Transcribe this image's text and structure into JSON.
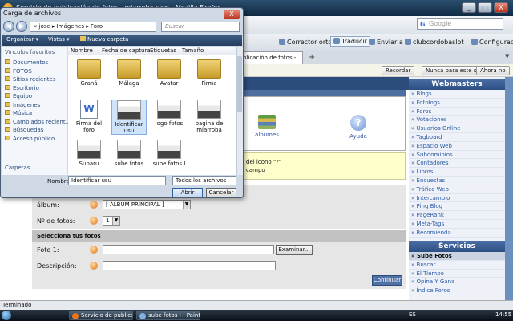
{
  "firefox": {
    "title": "Servicio de publicación de fotos - miarroba.com - Mozilla Firefox",
    "search_placeholder": "Google",
    "search_icon_letter": "G",
    "toolbar": {
      "spelling": "Corrector ortográfico",
      "translate": "Traducir",
      "send": "Enviar a",
      "bookmark": "clubcordobaslot",
      "config": "Configuración"
    },
    "tab_label": "blicación de fotos -",
    "notify": {
      "remember": "Recordar",
      "never": "Nunca para este sitio",
      "not_now": "Ahora no"
    },
    "status": "Terminado"
  },
  "window_buttons": {
    "minimize": "_",
    "maximize": "□",
    "close": "X"
  },
  "dialog": {
    "title": "Carga de archivos",
    "close": "X",
    "nav_back": "◀",
    "nav_forward": "▶",
    "address": "« jose ▸ Imágenes ▸ Foro",
    "search_placeholder": "Buscar",
    "toolbar": {
      "organize": "Organizar ▾",
      "views": "Vistas ▾",
      "new_folder": "Nueva carpeta"
    },
    "favorites_heading": "Vínculos favoritos",
    "favorites": [
      "Documentos",
      "FOTOS",
      "Sitios recientes",
      "Escritorio",
      "Equipo",
      "Imágenes",
      "Música",
      "Cambiados recient...",
      "Búsquedas",
      "Acceso público"
    ],
    "folders_label": "Carpetas",
    "columns": [
      "Nombre",
      "Fecha de captura",
      "Etiquetas",
      "Tamaño"
    ],
    "files": [
      {
        "name": "Graná",
        "type": "folder"
      },
      {
        "name": "Málaga",
        "type": "folder"
      },
      {
        "name": "Avatar",
        "type": "folder"
      },
      {
        "name": "Firma",
        "type": "folder"
      },
      {
        "name": "Firma del foro",
        "type": "doc"
      },
      {
        "name": "Identificar usu",
        "type": "image",
        "selected": true
      },
      {
        "name": "logo fotos",
        "type": "image"
      },
      {
        "name": "pagina de miarroba",
        "type": "image"
      },
      {
        "name": "Subaru",
        "type": "image"
      },
      {
        "name": "sube fotos",
        "type": "image"
      },
      {
        "name": "sube fotos I",
        "type": "image"
      }
    ],
    "filename_label": "Nombre:",
    "filename_value": "Identificar usu",
    "filter": "Todos los archivos",
    "open": "Abrir",
    "cancel": "Cancelar"
  },
  "page": {
    "icons": [
      {
        "label": "álbumes"
      },
      {
        "label": "Ayuda"
      }
    ],
    "notice_line1": "del icono \"?\"",
    "notice_line2": "campo",
    "form": {
      "album_label": "álbum:",
      "album_value": "[ ÁLBUM PRINCIPAL ]",
      "count_label": "Nº de fotos:",
      "count_value": "1",
      "section_title": "Selecciona tus fotos",
      "photo_label": "Foto 1:",
      "browse": "Examinar...",
      "desc_label": "Descripción:",
      "continue": "Continuar"
    }
  },
  "sidebar": {
    "webmasters_title": "Webmasters",
    "webmasters": [
      "Blogs",
      "Fotologs",
      "Foros",
      "Votaciones",
      "Usuarios Online",
      "Tagboard",
      "Espacio Web",
      "Subdominios",
      "Contadores",
      "Libros",
      "Encuestas",
      "Tráfico Web",
      "Intercambio",
      "Ping Blog",
      "PageRank",
      "Meta-Tags",
      "Recomienda"
    ],
    "services_title": "Servicios",
    "services": [
      "Sube Fotos",
      "Buscar",
      "El Tiempo",
      "Opina Y Gana",
      "Índice Foros"
    ]
  },
  "taskbar": {
    "items": [
      "Servicio de publicac...",
      "sube fotos I - Paint"
    ],
    "lang": "ES",
    "clock": "14:55"
  }
}
